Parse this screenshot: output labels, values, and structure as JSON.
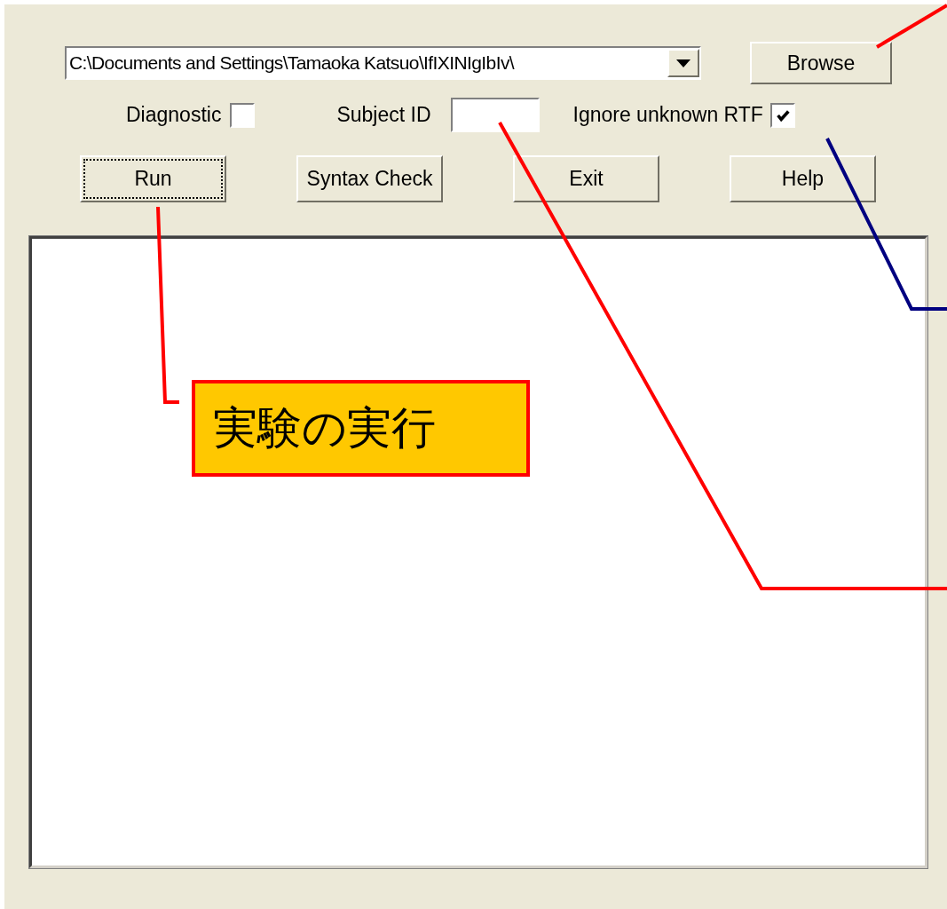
{
  "path_field": {
    "value": "C:\\Documents and Settings\\Tamaoka Katsuo\\IfIXINIgIbIv\\"
  },
  "browse_button": "Browse",
  "options": [
    {
      "kind": "checkbox",
      "label": "Diagnostic",
      "checked": false
    },
    {
      "kind": "textfield",
      "label": "Subject ID"
    },
    {
      "kind": "checkbox",
      "label": "Ignore unknown RTF",
      "checked": true
    }
  ],
  "buttons": [
    {
      "label": "Run",
      "focused": true
    },
    {
      "label": "Syntax Check",
      "focused": false
    },
    {
      "label": "Exit",
      "focused": false
    },
    {
      "label": "Help",
      "focused": false
    }
  ],
  "callout": "実験の実行"
}
